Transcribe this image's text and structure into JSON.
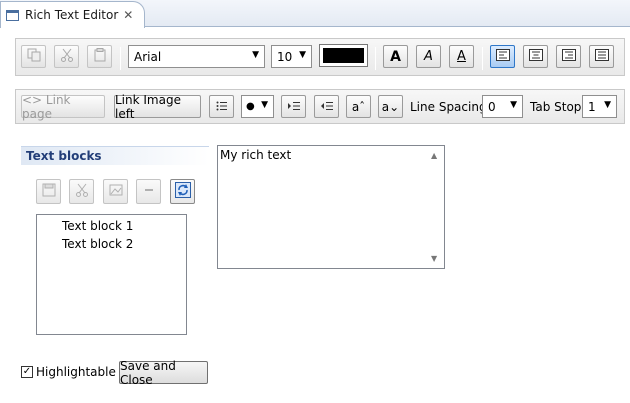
{
  "tab": {
    "title": "Rich Text Editor",
    "close_icon": "close-icon"
  },
  "toolbar1": {
    "font_family": "Arial",
    "font_size": "10",
    "text_color": "#000000",
    "bold_label": "A",
    "italic_label": "A",
    "underline_label": "A",
    "icons": [
      "copy-icon",
      "cut-icon",
      "paste-icon",
      "align-left-icon",
      "align-center-icon",
      "align-right-icon",
      "align-justify-icon"
    ]
  },
  "toolbar2": {
    "link_page_label": "<> Link page",
    "link_image_label": "Link Image left",
    "bullet_value": "●",
    "superscript_label": "aˆ",
    "subscript_label": "a⌄",
    "line_spacing_label": "Line Spacing",
    "line_spacing_value": "0",
    "tab_stop_label": "Tab Stop",
    "tab_stop_value": "1"
  },
  "text_blocks": {
    "header": "Text blocks",
    "items": [
      "Text block 1",
      "Text block 2"
    ]
  },
  "editor": {
    "content": "My rich text"
  },
  "footer": {
    "highlightable_label": "Highlightable",
    "highlightable_checked": "✓",
    "save_label": "Save and Close"
  }
}
